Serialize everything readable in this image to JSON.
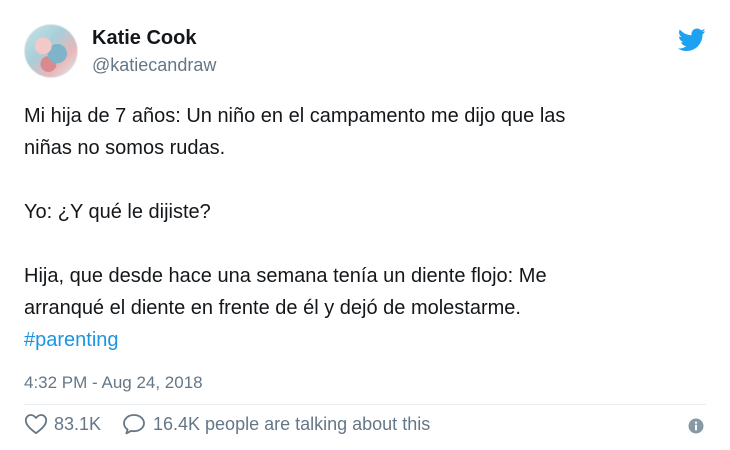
{
  "author": {
    "display_name": "Katie Cook",
    "handle": "@katiecandraw"
  },
  "tweet": {
    "line1": "Mi hija de 7 años: Un niño en el campamento me dijo que las",
    "line2": "niñas no somos rudas.",
    "line3": "Yo: ¿Y qué le dijiste?",
    "line4": "Hija, que desde hace una semana tenía un diente flojo: Me",
    "line5": "arranqué el diente en frente de él y dejó de molestarme.",
    "hashtag": "#parenting",
    "timestamp": "4:32 PM - Aug 24, 2018"
  },
  "stats": {
    "likes": "83.1K",
    "conversation": "16.4K people are talking about this"
  },
  "icons": {
    "brand": "twitter-bird-icon",
    "like": "heart-icon",
    "reply": "speech-bubble-icon",
    "info": "info-icon"
  },
  "colors": {
    "brand_blue": "#1da1f2",
    "hashtag": "#1b95e0",
    "secondary_text": "#657786"
  }
}
